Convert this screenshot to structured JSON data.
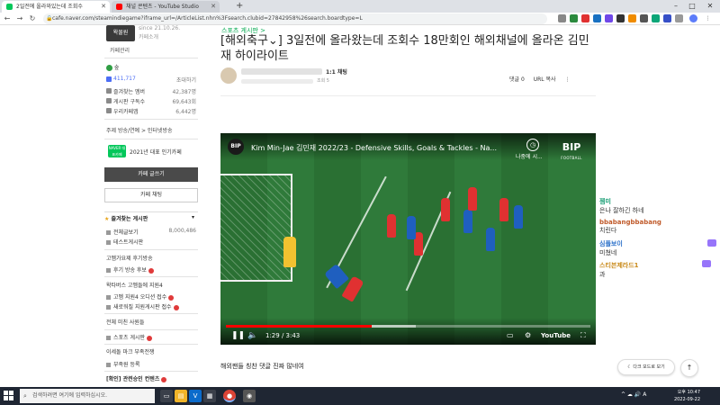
{
  "browser": {
    "tabs": [
      {
        "title": "2일전에 올라와있는데 조회수",
        "favicon_color": "#03c75a",
        "active": true
      },
      {
        "title": "채널 콘텐츠 - YouTube Studio",
        "favicon_color": "#ff0000",
        "active": false
      }
    ],
    "new_tab_symbol": "+",
    "url": "cafe.naver.com/steamindiegame?iframe_url=/ArticleList.nhn%3Fsearch.clubid=27842958%26search.boardtype=L",
    "window_controls": {
      "minimize": "–",
      "maximize": "□",
      "close": "✕"
    }
  },
  "sidebar": {
    "avatar_text": "왁물원",
    "since": "since 21.10.26.",
    "intro": "카페소개",
    "manage": "카페관리",
    "grade_label": "숲",
    "stats": [
      {
        "label": "411,717",
        "value": "초대하기"
      },
      {
        "label": "즐겨찾는 멤버",
        "value": "42,387명"
      },
      {
        "label": "게시판 구독수",
        "value": "69,643회"
      },
      {
        "label": "우리카페앱",
        "value": "6,442명"
      }
    ],
    "tags": "주제 방송/연예 > 인터넷방송",
    "naver_badge": "NAVER 대표카페",
    "popular": "2021년 대표 인기카페",
    "write_button": "카페 글쓰기",
    "chat_button": "카페 채팅",
    "favorites_header": "즐겨찾는 게시판",
    "favorites": [
      {
        "label": "전체글보기",
        "count": "8,000,486"
      },
      {
        "label": "테스트게시판",
        "count": ""
      }
    ],
    "menu": [
      {
        "label": "고멤가요제 후기방송",
        "new": false
      },
      {
        "label": "후기 방송 후보",
        "new": true
      },
      {
        "label": "왁타버스 고멤들에 지원4",
        "new": false
      },
      {
        "label": "고멤 지원4 오디션 접수",
        "new": true
      },
      {
        "label": "새로워질 지원게시판 접수",
        "new": true
      },
      {
        "label": "전체 미친 사원들",
        "new": false
      },
      {
        "label": "스포츠 게시판",
        "new": true
      },
      {
        "label": "이세돌 마크 부족전쟁",
        "new": false
      },
      {
        "label": "부족원 등록",
        "new": false
      },
      {
        "label": "[확인] 관련승인 컨텐츠",
        "new": true
      }
    ]
  },
  "article": {
    "breadcrumb": "스포츠 게시판 >",
    "title_prefix": "[해외축구⌄]",
    "title": "3일전에 올라왔는데 조회수 18만회인 해외채널에 올라온 김민재 하이라이트",
    "author_grade": "1:1 채팅",
    "meta": "조회 5",
    "actions": {
      "comments": "댓글 0",
      "url_copy": "URL 복사",
      "more": "⋮"
    },
    "caption": "해외팬들 칭찬 댓글 진짜 많네여"
  },
  "video": {
    "channel_logo": "BIP",
    "title": "Kim Min-Jae 김민재 2022/23 - Defensive Skills, Goals & Tackles - Na...",
    "share_label": "나중에 시...",
    "brand_logo": "BIP",
    "brand_sub": "FOOTBALL",
    "current_time": "1:29",
    "duration": "3:43",
    "time_display": "1:29 / 3:43",
    "progress_fraction": 0.4,
    "buffer_fraction": 0.52,
    "youtube_label": "YouTube",
    "controls": {
      "play": "▶︎❚❚",
      "next": "⏭",
      "volume": "🔊",
      "subtitles": "▭",
      "settings": "⚙",
      "fullscreen": "⛶"
    }
  },
  "chat": [
    {
      "user": "젬미",
      "user_color": "#1a9e75",
      "msg": "은나 잘하긴 하네"
    },
    {
      "user": "bbabangbbabang",
      "user_color": "#c05a2a",
      "msg": "치린다"
    },
    {
      "user": "심플보이",
      "user_color": "#2a6fc9",
      "msg": "미쳤네"
    },
    {
      "user": "스티븐제라드1",
      "user_color": "#c98a1a",
      "msg": "과"
    }
  ],
  "floating": {
    "dark_mode": "다크 모드로 보기",
    "top": "↑"
  },
  "taskbar": {
    "search_placeholder": "검색하려면 여기에 입력하십시오.",
    "time": "오후 10:47",
    "date": "2022-09-22",
    "tray_misc": "^ ☁ 🔊 A"
  }
}
